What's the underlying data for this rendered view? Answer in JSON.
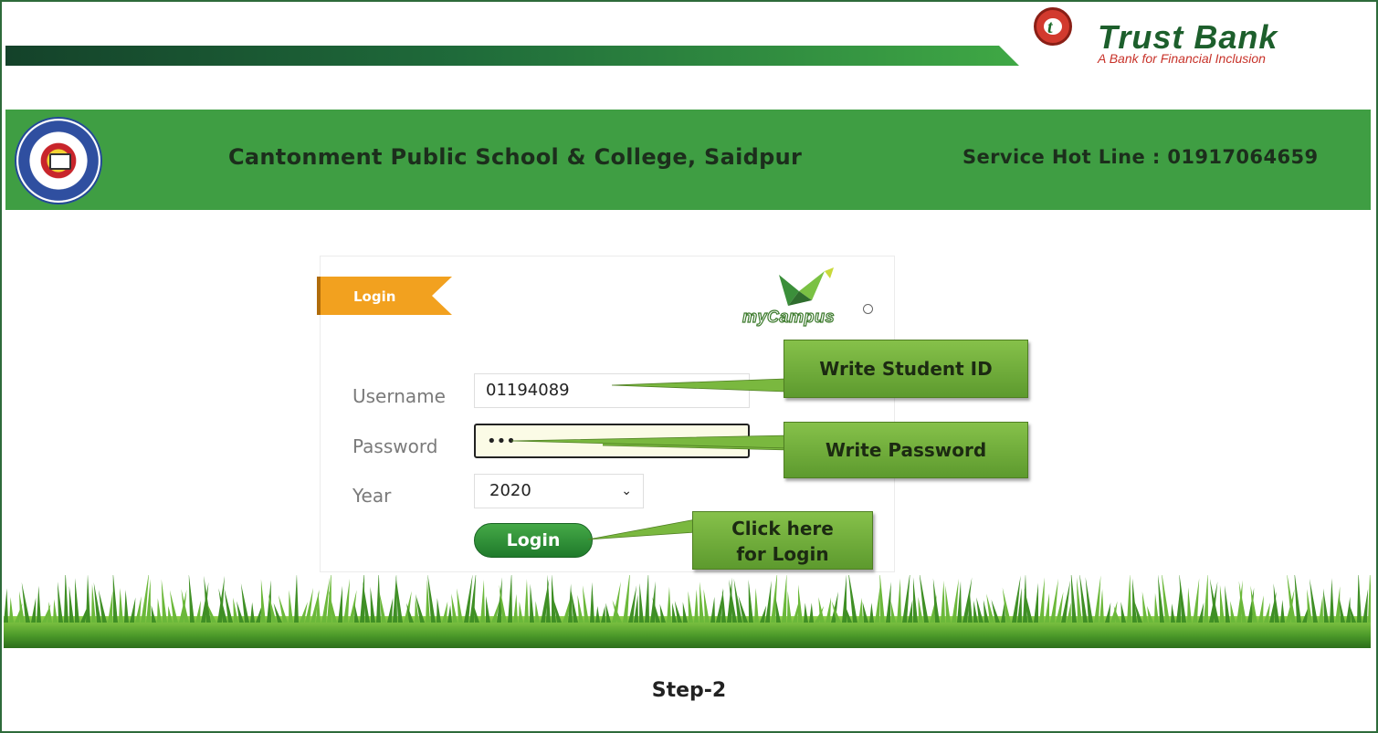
{
  "bank": {
    "name": "Trust Bank",
    "tagline": "A Bank for Financial Inclusion",
    "colors": {
      "green": "#1d5f2c",
      "red": "#c8332a"
    }
  },
  "header": {
    "school_name": "Cantonment Public School & College, Saidpur",
    "hotline": "Service Hot Line : 01917064659",
    "background": "#3f9e43"
  },
  "login_panel": {
    "tab_label": "Login",
    "brand": "myCampus",
    "fields": {
      "username_label": "Username",
      "username_value": "01194089",
      "password_label": "Password",
      "password_value": "•••",
      "year_label": "Year",
      "year_value": "2020"
    },
    "login_button": "Login"
  },
  "callouts": {
    "student_id": "Write Student ID",
    "password": "Write Password",
    "login_line1": "Click here",
    "login_line2": "for Login"
  },
  "footer": {
    "step": "Step-2"
  }
}
